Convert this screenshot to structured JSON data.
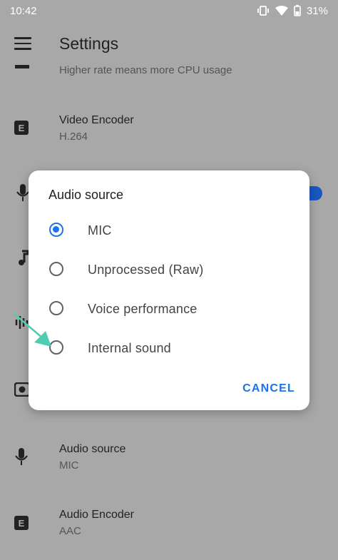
{
  "status_bar": {
    "time": "10:42",
    "battery": "31%"
  },
  "app_bar": {
    "title": "Settings"
  },
  "background_rows": [
    {
      "subtitle": "Higher rate means more CPU usage"
    },
    {
      "title": "Video Encoder",
      "subtitle": "H.264"
    },
    {
      "title": "Audio source",
      "subtitle": "MIC"
    },
    {
      "title": "Audio Encoder",
      "subtitle": "AAC"
    }
  ],
  "dialog": {
    "title": "Audio source",
    "options": [
      {
        "label": "MIC",
        "selected": true
      },
      {
        "label": "Unprocessed (Raw)",
        "selected": false
      },
      {
        "label": "Voice performance",
        "selected": false
      },
      {
        "label": "Internal sound",
        "selected": false
      }
    ],
    "cancel_label": "CANCEL"
  },
  "colors": {
    "accent": "#1a73e8",
    "pointer_arrow": "#4ecdb0",
    "scrim": "#a8a8a8"
  }
}
